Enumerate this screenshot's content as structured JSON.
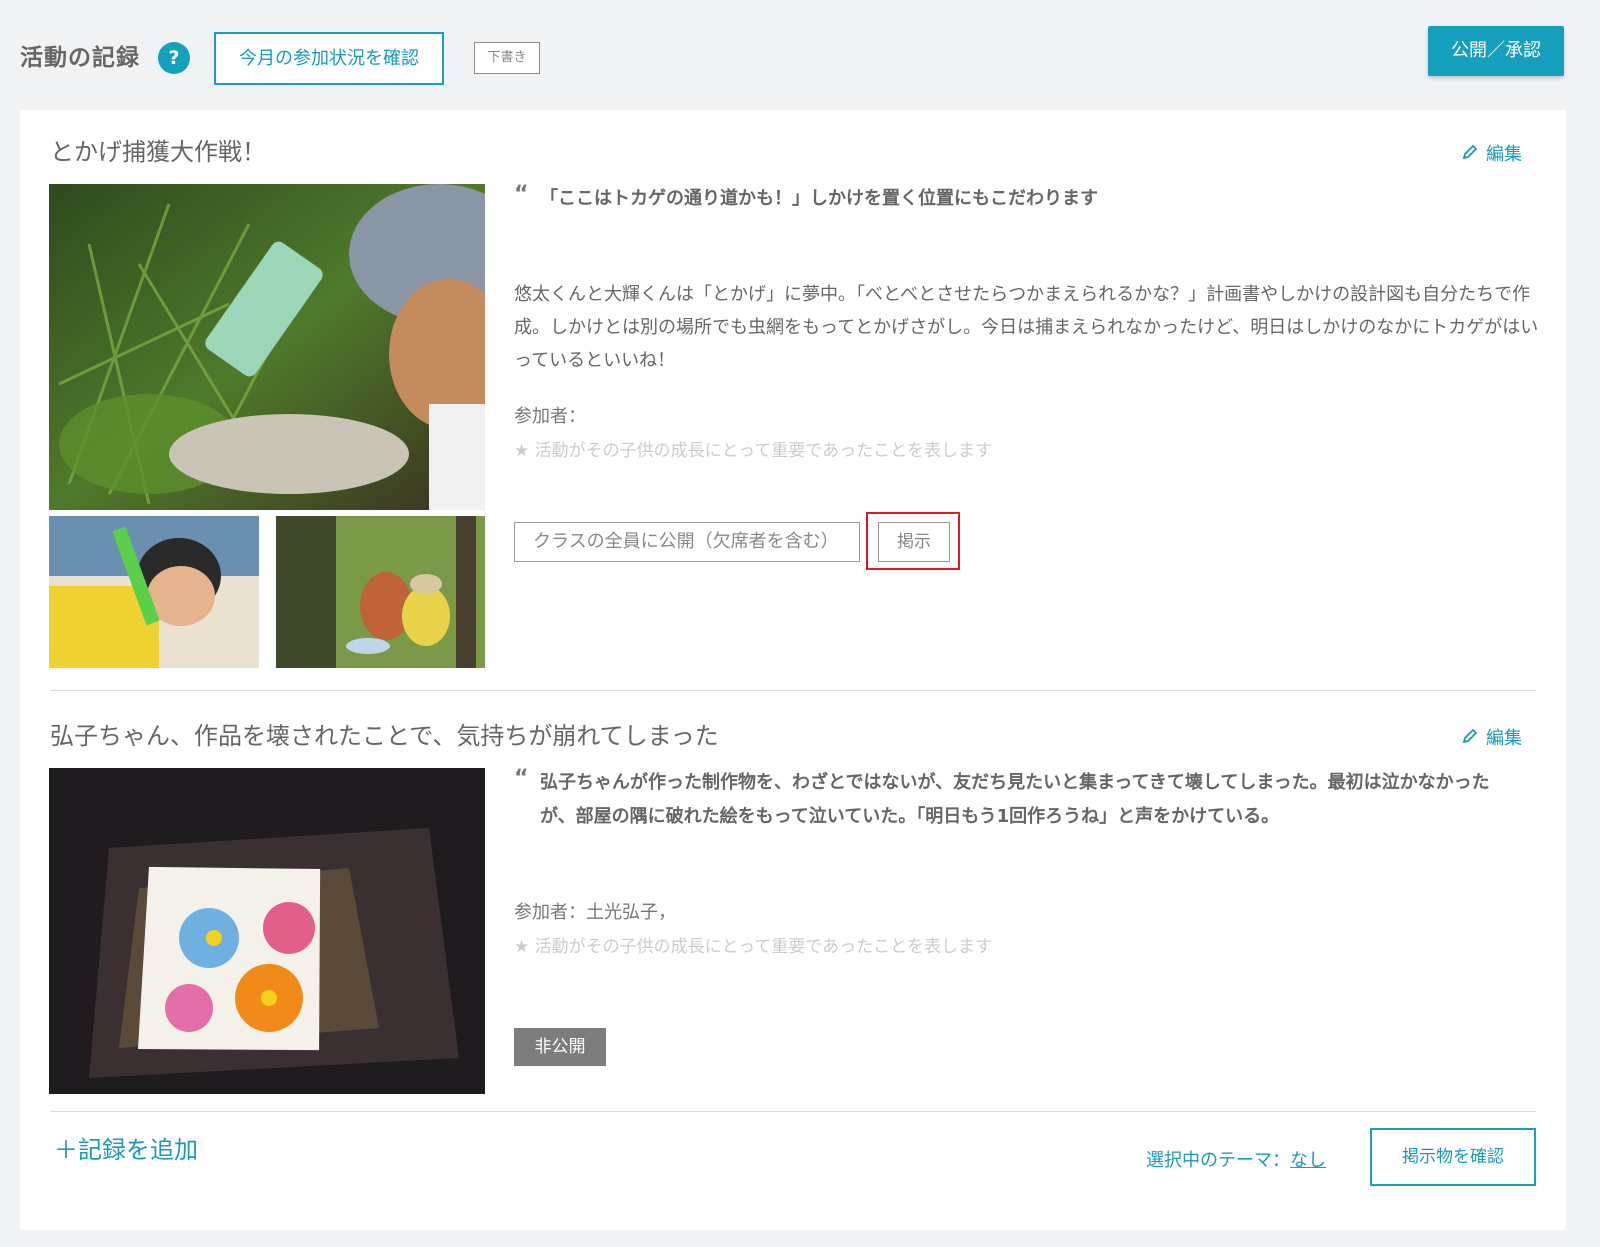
{
  "header": {
    "title": "活動の記録",
    "help_icon": "?",
    "check_participation_label": "今月の参加状況を確認",
    "draft_label": "下書き",
    "publish_label": "公開／承認"
  },
  "records": [
    {
      "title": "とかげ捕獲大作戦！",
      "edit_label": "編集",
      "quote": "「ここはトカゲの通り道かも！」しかけを置く位置にもこだわります",
      "description": "悠太くんと大輝くんは「とかげ」に夢中。「べとべとさせたらつかまえられるかな？」計画書やしかけの設計図も自分たちで作成。しかけとは別の場所でも虫網をもってとかげさがし。今日は捕まえられなかったけど、明日はしかけのなかにトカゲがはいっているといいね！",
      "participants_label": "参加者：",
      "participants": "",
      "star_note": "★ 活動がその子供の成長にとって重要であったことを表します",
      "scope_label": "クラスの全員に公開（欠席者を含む）",
      "post_label": "掲示"
    },
    {
      "title": "弘子ちゃん、作品を壊されたことで、気持ちが崩れてしまった",
      "edit_label": "編集",
      "quote": "弘子ちゃんが作った制作物を、わざとではないが、友だち見たいと集まってきて壊してしまった。最初は泣かなかったが、部屋の隅に破れた絵をもって泣いていた。「明日もう1回作ろうね」と声をかけている。",
      "participants_label": "参加者：",
      "participants": "土光弘子，",
      "star_note": "★ 活動がその子供の成長にとって重要であったことを表します",
      "private_label": "非公開"
    }
  ],
  "footer": {
    "add_record_label": "＋記録を追加",
    "theme_label": "選択中のテーマ：",
    "theme_value": "なし",
    "check_postings_label": "掲示物を確認"
  },
  "colors": {
    "accent": "#16a0bd",
    "highlight": "#e01b22",
    "private_badge": "#7d7d7d"
  }
}
